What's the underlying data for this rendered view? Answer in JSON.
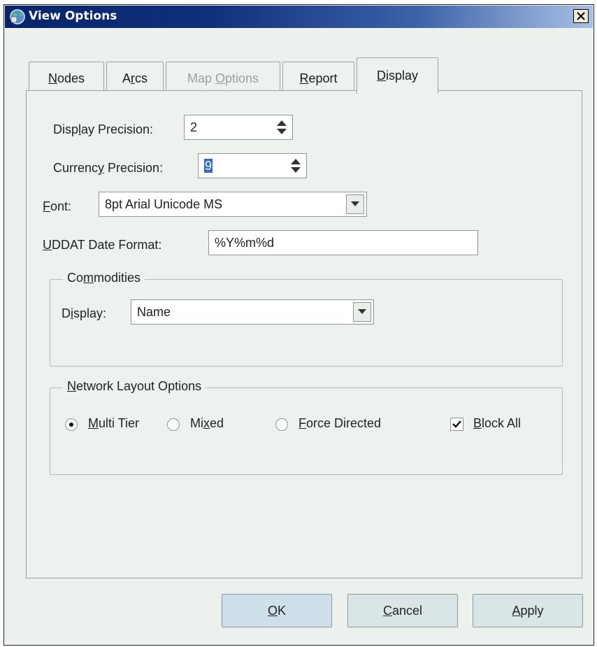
{
  "window": {
    "title": "View Options",
    "icon": "globe-icon",
    "close_icon": "close-icon"
  },
  "tabs": [
    {
      "label_pre": "",
      "mnemonic": "N",
      "label_post": "odes",
      "enabled": true,
      "active": false
    },
    {
      "label_pre": "A",
      "mnemonic": "r",
      "label_post": "cs",
      "enabled": true,
      "active": false
    },
    {
      "label_pre": "Map ",
      "mnemonic": "O",
      "label_post": "ptions",
      "enabled": false,
      "active": false
    },
    {
      "label_pre": "",
      "mnemonic": "R",
      "label_post": "eport",
      "enabled": true,
      "active": false
    },
    {
      "label_pre": "",
      "mnemonic": "D",
      "label_post": "isplay",
      "enabled": true,
      "active": true
    }
  ],
  "display_precision": {
    "label_pre": "Disp",
    "mnemonic": "l",
    "label_post": "ay Precision:",
    "value": "2"
  },
  "currency_precision": {
    "label_pre": "Currenc",
    "mnemonic": "y",
    "label_post": " Precision:",
    "value": "9"
  },
  "font": {
    "mnemonic": "F",
    "label_post": "ont:",
    "value": "8pt Arial Unicode MS"
  },
  "date_format": {
    "mnemonic": "U",
    "label_post": "DDAT Date Format:",
    "value": "%Y%m%d"
  },
  "commodities": {
    "legend_pre": "Co",
    "legend_mnemonic": "m",
    "legend_post": "modities",
    "display_label_pre": "D",
    "display_mnemonic": "i",
    "display_label_post": "splay:",
    "display_value": "Name"
  },
  "network_layout": {
    "legend_mnemonic": "N",
    "legend_post": "etwork Layout Options",
    "options": [
      {
        "label_pre": "",
        "mnemonic": "M",
        "label_post": "ulti Tier",
        "selected": true
      },
      {
        "label_pre": "Mi",
        "mnemonic": "x",
        "label_post": "ed",
        "selected": false
      },
      {
        "label_pre": "",
        "mnemonic": "F",
        "label_post": "orce Directed",
        "selected": false
      }
    ],
    "block_all": {
      "mnemonic": "B",
      "label_post": "lock All",
      "checked": true
    }
  },
  "buttons": {
    "ok": {
      "mnemonic": "O",
      "label_post": "K"
    },
    "cancel": {
      "mnemonic": "C",
      "label_post": "ancel"
    },
    "apply": {
      "mnemonic": "A",
      "label_post": "pply"
    }
  },
  "colors": {
    "title_bar": "#0a2a72",
    "dialog_bg": "#ecf1ee",
    "selection": "#316ac5"
  }
}
